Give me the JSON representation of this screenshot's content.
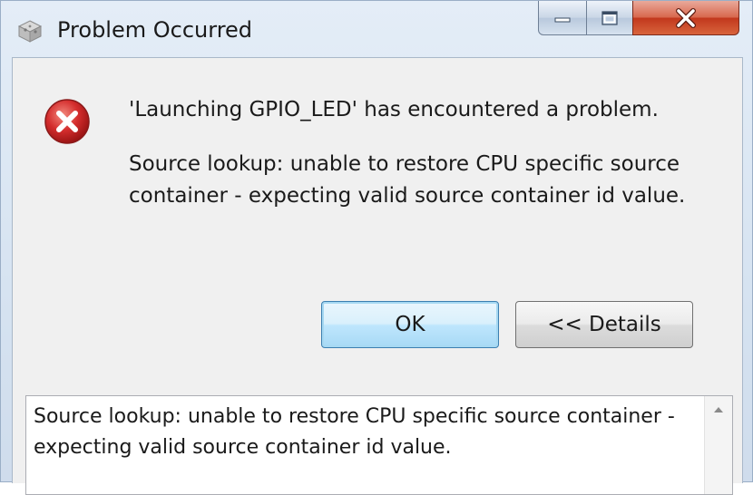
{
  "window": {
    "title": "Problem Occurred"
  },
  "message": {
    "title": "'Launching GPIO_LED' has encountered a problem.",
    "detail": "Source lookup: unable to restore CPU specific source container - expecting valid source container id value."
  },
  "buttons": {
    "ok_label": "OK",
    "details_label": "<< Details"
  },
  "details": {
    "text": "Source lookup: unable to restore CPU specific source container - expecting valid source container id value."
  },
  "icons": {
    "app": "eclipse-cube-icon",
    "error": "error-icon",
    "minimize": "minimize-icon",
    "maximize": "maximize-icon",
    "close": "close-icon",
    "scroll_up": "scroll-up-arrow-icon"
  },
  "colors": {
    "error_red": "#d42d2d",
    "close_button": "#c2381d",
    "default_button_border": "#3c7fb1"
  }
}
